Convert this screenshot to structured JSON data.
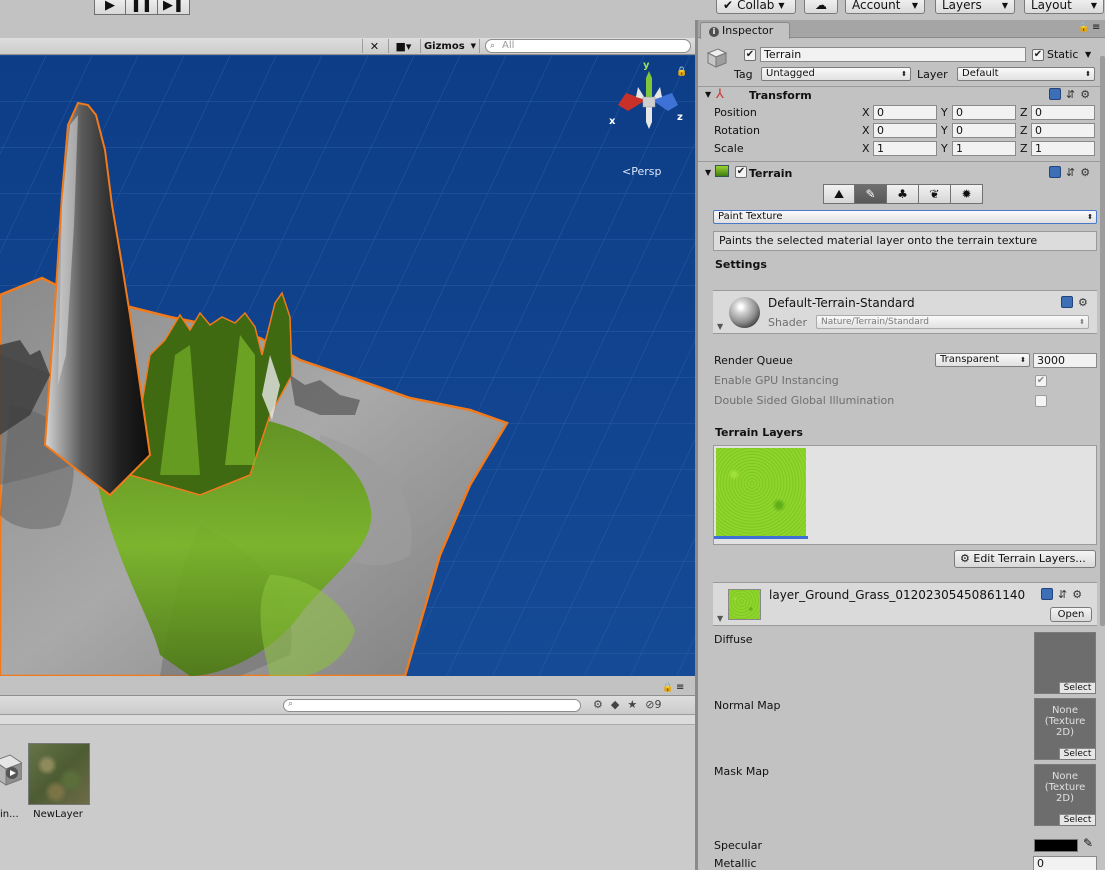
{
  "toolbar": {
    "play": "▶",
    "pause": "❚❚",
    "step": "▶❚",
    "collab": "Collab",
    "account": "Account",
    "layers": "Layers",
    "layout": "Layout"
  },
  "scene": {
    "gizmos": "Gizmos",
    "search_placeholder": "All",
    "persp_label": "Persp",
    "axis_y": "y",
    "axis_x": "x",
    "axis_z": "z"
  },
  "project": {
    "asset_truncated": "in...",
    "asset_name": "NewLayer",
    "hidden_count": "9"
  },
  "inspector": {
    "tab": "Inspector",
    "object_name": "Terrain",
    "static_label": "Static",
    "tag_label": "Tag",
    "tag_value": "Untagged",
    "layer_label": "Layer",
    "layer_value": "Default",
    "transform": {
      "title": "Transform",
      "rows": [
        {
          "label": "Position",
          "x": "0",
          "y": "0",
          "z": "0"
        },
        {
          "label": "Rotation",
          "x": "0",
          "y": "0",
          "z": "0"
        },
        {
          "label": "Scale",
          "x": "1",
          "y": "1",
          "z": "1"
        }
      ],
      "axis_x": "X",
      "axis_y": "Y",
      "axis_z": "Z"
    },
    "terrain": {
      "title": "Terrain",
      "mode": "Paint Texture",
      "help": "Paints the selected material layer onto the terrain texture",
      "settings": "Settings",
      "material_name": "Default-Terrain-Standard",
      "shader_label": "Shader",
      "shader_value": "Nature/Terrain/Standard",
      "render_queue_label": "Render Queue",
      "render_queue_mode": "Transparent",
      "render_queue_value": "3000",
      "gpu_instancing": "Enable GPU Instancing",
      "double_sided": "Double Sided Global Illumination",
      "layers_title": "Terrain Layers",
      "edit_layers": "Edit Terrain Layers...",
      "layer_name": "layer_Ground_Grass_01202305450861140",
      "open": "Open",
      "diffuse": "Diffuse",
      "normal_map": "Normal Map",
      "mask_map": "Mask Map",
      "specular": "Specular",
      "metallic": "Metallic",
      "metallic_value": "0",
      "none_texture": "None (Texture 2D)",
      "select": "Select"
    }
  },
  "colors": {
    "sky": "#0f3f86",
    "selection_outline": "#f07a1c",
    "grass": "#86cf27"
  }
}
